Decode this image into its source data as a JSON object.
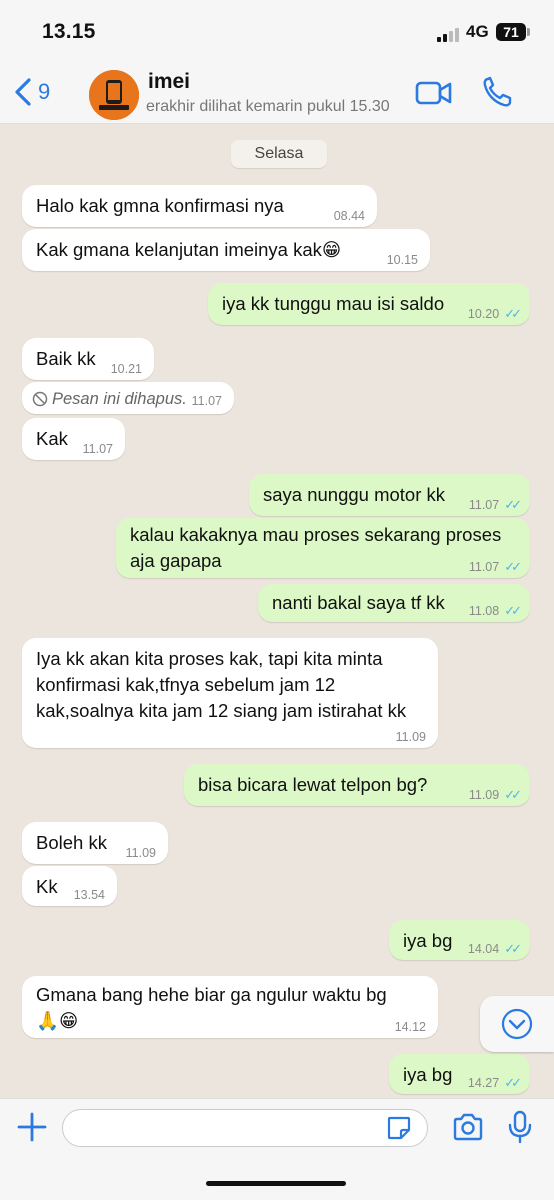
{
  "status_bar": {
    "time": "13.15",
    "network": "4G",
    "battery": "71"
  },
  "header": {
    "back_count": "9",
    "contact_name": "imei",
    "last_seen": "erakhir dilihat kemarin pukul 15.30"
  },
  "chat": {
    "date_label": "Selasa",
    "messages": [
      {
        "dir": "in",
        "text": "Halo kak gmna konfirmasi nya",
        "time": "08.44"
      },
      {
        "dir": "in",
        "text": "Kak gmana kelanjutan imeinya kak😁",
        "time": "10.15"
      },
      {
        "dir": "out",
        "text": "iya kk tunggu mau isi saldo",
        "time": "10.20"
      },
      {
        "dir": "in",
        "text": "Baik kk",
        "time": "10.21"
      },
      {
        "dir": "in",
        "text": "Pesan ini dihapus.",
        "time": "11.07",
        "deleted": true
      },
      {
        "dir": "in",
        "text": "Kak",
        "time": "11.07"
      },
      {
        "dir": "out",
        "text": "saya nunggu motor kk",
        "time": "11.07"
      },
      {
        "dir": "out",
        "text": "kalau kakaknya mau proses sekarang proses\naja gapapa",
        "time": "11.07"
      },
      {
        "dir": "out",
        "text": "nanti bakal saya tf kk",
        "time": "11.08"
      },
      {
        "dir": "in",
        "text": "Iya kk akan kita proses kak, tapi kita minta\nkonfirmasi kak,tfnya sebelum jam 12\nkak,soalnya kita jam 12 siang jam istirahat kk",
        "time": "11.09"
      },
      {
        "dir": "out",
        "text": "bisa bicara lewat telpon bg?",
        "time": "11.09"
      },
      {
        "dir": "in",
        "text": "Boleh kk",
        "time": "11.09"
      },
      {
        "dir": "in",
        "text": "Kk",
        "time": "13.54"
      },
      {
        "dir": "out",
        "text": "iya bg",
        "time": "14.04"
      },
      {
        "dir": "in",
        "text": "Gmana bang hehe biar ga ngulur waktu bg\n🙏😁",
        "time": "14.12"
      },
      {
        "dir": "out",
        "text": "iya bg",
        "time": "14.27"
      }
    ]
  },
  "input": {
    "placeholder": ""
  },
  "colors": {
    "incoming": "#ffffff",
    "outgoing": "#dcf8c6",
    "accent": "#2a7ae2",
    "read_ticks": "#4fb6ec"
  }
}
